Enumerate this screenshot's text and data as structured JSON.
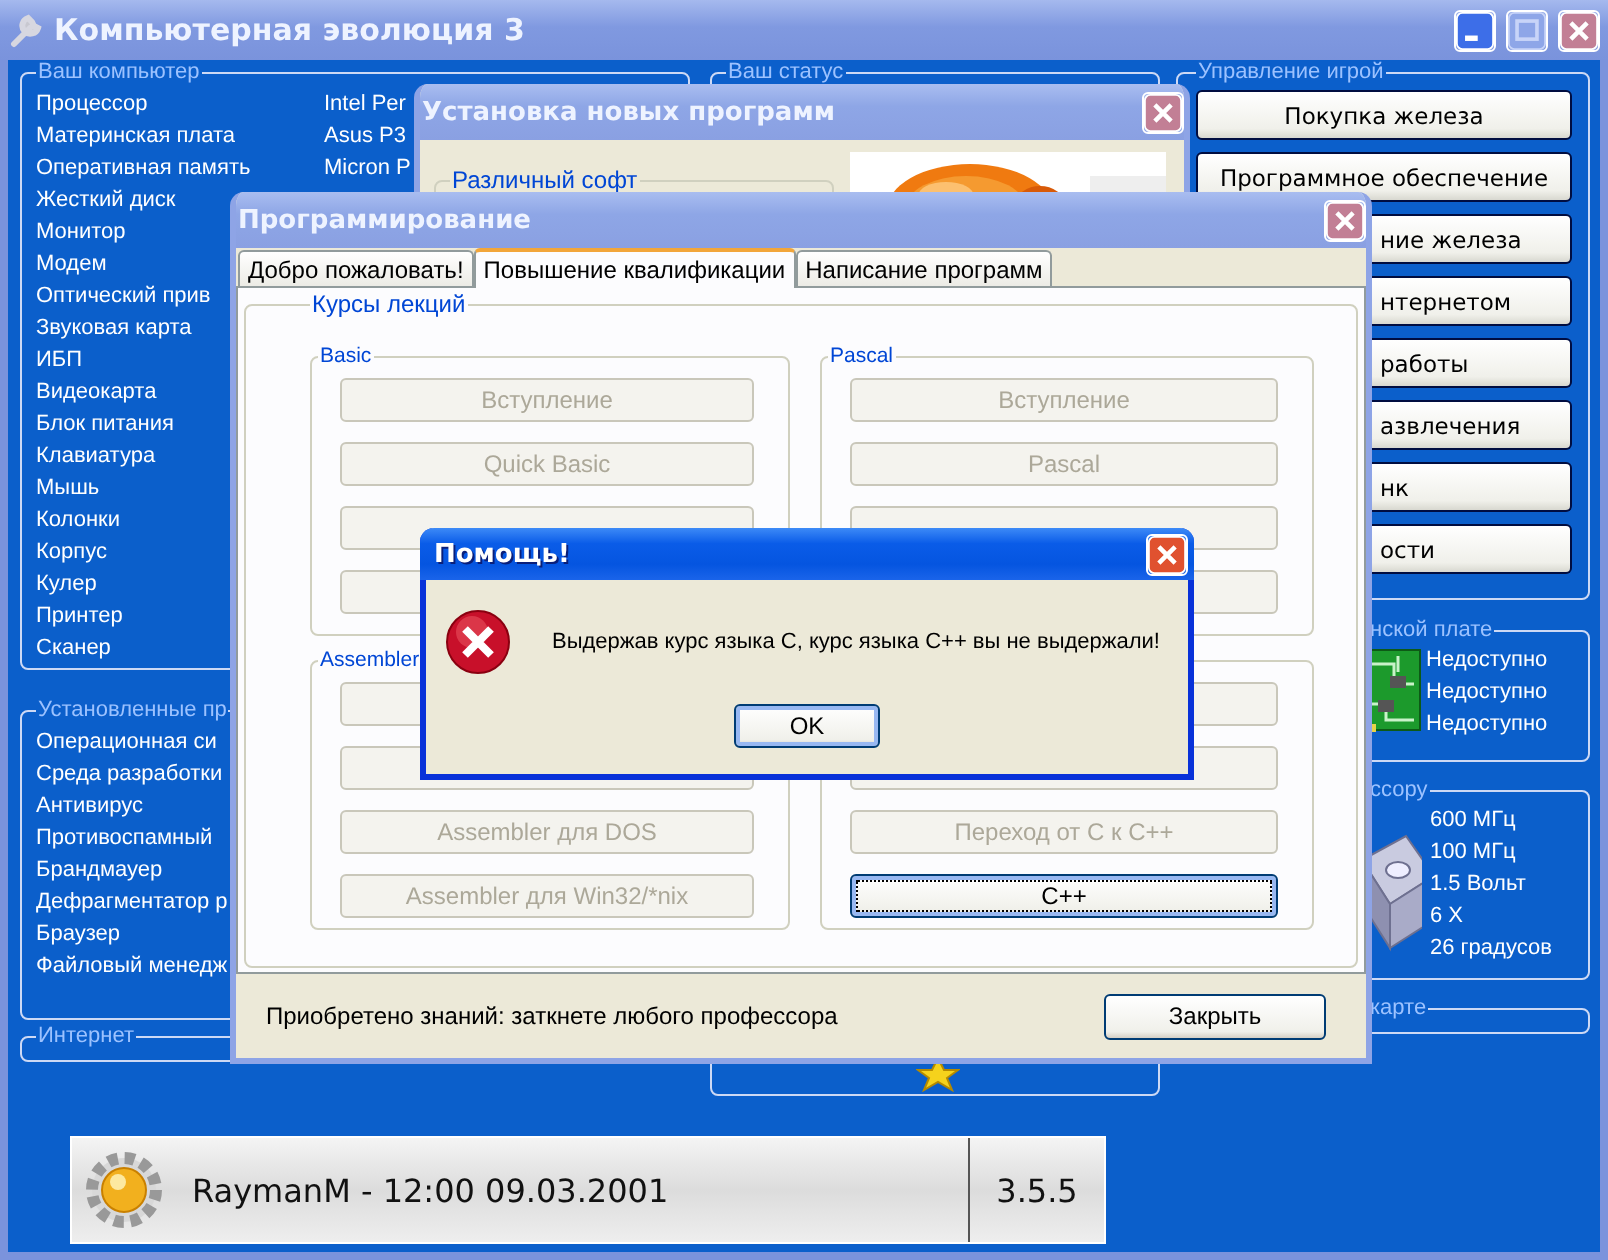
{
  "main_window": {
    "title": "Компьютерная эволюция 3"
  },
  "computer": {
    "title": "Ваш компьютер",
    "items": [
      {
        "label": "Процессор",
        "value": "Intel Per"
      },
      {
        "label": "Материнская плата",
        "value": "Asus P3"
      },
      {
        "label": "Оперативная память",
        "value": "Micron P"
      },
      {
        "label": "Жесткий диск"
      },
      {
        "label": "Монитор"
      },
      {
        "label": "Модем"
      },
      {
        "label": "Оптический прив"
      },
      {
        "label": "Звуковая карта"
      },
      {
        "label": "ИБП"
      },
      {
        "label": "Видеокарта"
      },
      {
        "label": "Блок питания"
      },
      {
        "label": "Клавиатура"
      },
      {
        "label": "Мышь"
      },
      {
        "label": "Колонки"
      },
      {
        "label": "Корпус"
      },
      {
        "label": "Кулер"
      },
      {
        "label": "Принтер"
      },
      {
        "label": "Сканер"
      }
    ]
  },
  "installed": {
    "title": "Установленные пр",
    "items": [
      "Операционная си",
      "Среда разработки",
      "Антивирус",
      "Противоспамный",
      "Брандмауер",
      "Дефрагментатор р",
      "Браузер",
      "Файловый менедж"
    ]
  },
  "internet": {
    "title": "Интернет"
  },
  "status": {
    "title": "Ваш статус"
  },
  "game_control": {
    "title": "Управление игрой",
    "buttons": [
      "Покупка железа",
      "Программное обеспечение",
      "ние железа",
      "нтернетом",
      "работы",
      "азвлечения",
      "нк",
      "ости"
    ]
  },
  "motherboard": {
    "title": "нской плате",
    "values": [
      "Недоступно",
      "Недоступно",
      "Недоступно"
    ]
  },
  "processor": {
    "title": "ссору",
    "values": [
      "600 МГц",
      "100 МГц",
      "1.5 Вольт",
      "6 X",
      "26 градусов"
    ]
  },
  "videocard": {
    "title": "карте"
  },
  "taskbar": {
    "user_time": "RaymanM - 12:00 09.03.2001",
    "version": "3.5.5"
  },
  "installer_window": {
    "title": "Установка новых программ",
    "group": "Различный софт"
  },
  "programming_window": {
    "title": "Программирование",
    "tabs": [
      {
        "label": "Добро пожаловать!",
        "selected": false
      },
      {
        "label": "Повышение квалификации",
        "selected": true
      },
      {
        "label": "Написание программ",
        "selected": false
      }
    ],
    "group": "Курсы лекций",
    "course_groups": [
      {
        "title": "Basic",
        "buttons": [
          {
            "label": "Вступление",
            "disabled": true,
            "focused": false
          },
          {
            "label": "Quick Basic",
            "disabled": true,
            "focused": false
          },
          {
            "disabled": true,
            "focused": false
          },
          {
            "disabled": true,
            "focused": false
          }
        ]
      },
      {
        "title": "Pascal",
        "buttons": [
          {
            "label": "Вступление",
            "disabled": true,
            "focused": false
          },
          {
            "label": "Pascal",
            "disabled": true,
            "focused": false
          },
          {
            "disabled": true,
            "focused": false
          },
          {
            "disabled": true,
            "focused": false
          }
        ]
      },
      {
        "title": "Assembler",
        "buttons": [
          {
            "disabled": true,
            "focused": false
          },
          {
            "disabled": true,
            "focused": false
          },
          {
            "label": "Assembler для DOS",
            "disabled": true,
            "focused": false
          },
          {
            "label": "Assembler для Win32/*nix",
            "disabled": true,
            "focused": false
          }
        ]
      },
      {
        "buttons": [
          {
            "disabled": true,
            "focused": false
          },
          {
            "disabled": true,
            "focused": false
          },
          {
            "label": "Переход от C к C++",
            "disabled": true,
            "focused": false
          },
          {
            "label": "C++",
            "disabled": false,
            "focused": true
          }
        ]
      }
    ],
    "status": "Приобретено знаний: заткнете любого профессора",
    "close_button": "Закрыть"
  },
  "dialog": {
    "title": "Помощь!",
    "message": "Выдержав курс языка C, курс языка C++ вы не выдержали!",
    "ok_button": "OK"
  }
}
